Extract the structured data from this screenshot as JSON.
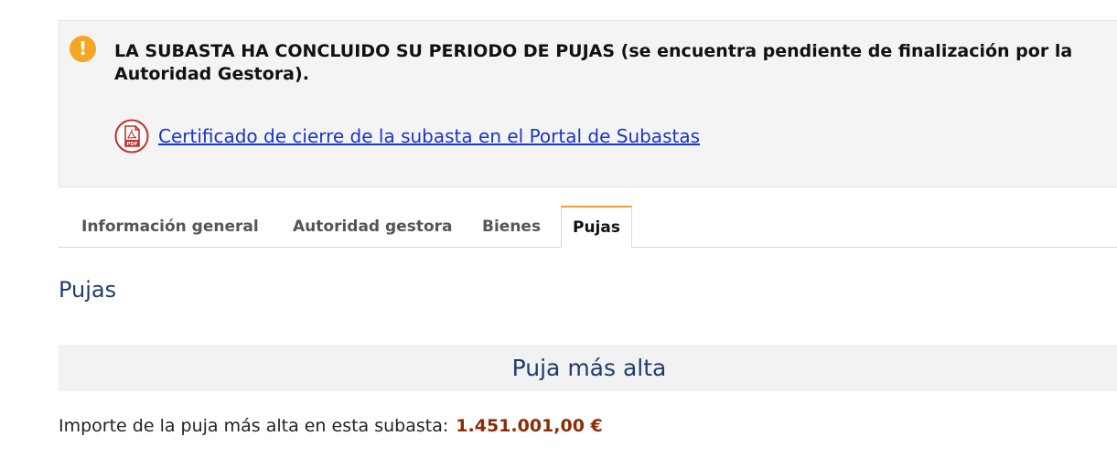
{
  "alert": {
    "icon": "warning-icon",
    "icon_glyph": "!",
    "headline": "LA SUBASTA HA CONCLUIDO SU PERIODO DE PUJAS (se encuentra pendiente de finalización por la Autoridad Gestora).",
    "pdf_icon": "pdf-document-icon",
    "link_text": "Certificado de cierre de la subasta en el Portal de Subastas",
    "colors": {
      "warning": "#f5a623",
      "pdf": "#c0302a",
      "link": "#1a34c8"
    }
  },
  "tabs": [
    {
      "label": "Información general",
      "active": false
    },
    {
      "label": "Autoridad gestora",
      "active": false
    },
    {
      "label": "Bienes",
      "active": false
    },
    {
      "label": "Pujas",
      "active": true
    }
  ],
  "main": {
    "section_title": "Pujas",
    "bid_header": "Puja más alta",
    "bid_label": "Importe de la puja más alta en esta subasta:",
    "bid_amount": "1.451.001,00 €",
    "colors": {
      "title": "#1f3c6b",
      "amount": "#8b2c06",
      "active_tab_accent": "#f0a030"
    }
  }
}
